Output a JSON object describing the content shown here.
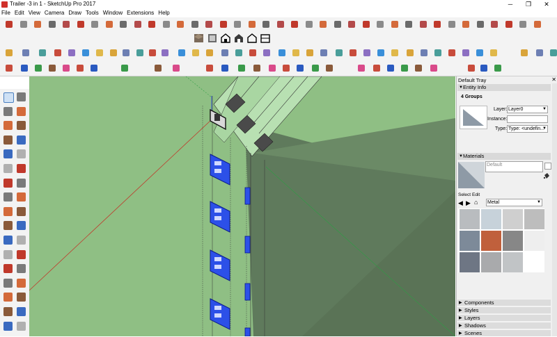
{
  "window": {
    "title": "Trailer -3 in 1 - SketchUp Pro 2017",
    "minimize": "─",
    "restore": "❐",
    "close": "✕"
  },
  "menu": [
    "File",
    "Edit",
    "View",
    "Camera",
    "Draw",
    "Tools",
    "Window",
    "Extensions",
    "Help"
  ],
  "colors": {
    "viewport_bg": "#8fbf84",
    "selection_blue": "#1f3fe0",
    "axis_red": "#c0392b",
    "axis_green": "#2e9e44",
    "tray_bg": "#f0f0f0"
  },
  "tray": {
    "title": "Default Tray",
    "close": "✕",
    "entity_info": {
      "header": "Entity Info",
      "selection": "4 Groups",
      "layer_label": "Layer:",
      "layer_value": "Layer0",
      "instance_label": "Instance:",
      "instance_value": "",
      "type_label": "Type:",
      "type_value": "Type: <undefin..."
    },
    "materials": {
      "header": "Materials",
      "current": "Default",
      "tab_select": "Select",
      "tab_edit": "Edit",
      "library": "Metal",
      "swatches": [
        "#b9bcbf",
        "#c7d2da",
        "#cfcfcf",
        "#bdbdbd",
        "#7d8a99",
        "#c0603c",
        "#878787",
        "#eeeeee",
        "#6e7684",
        "#a9aaac",
        "#c1c4c6"
      ]
    },
    "collapsed_panels": [
      "Components",
      "Styles",
      "Layers",
      "Shadows",
      "Scenes"
    ]
  }
}
